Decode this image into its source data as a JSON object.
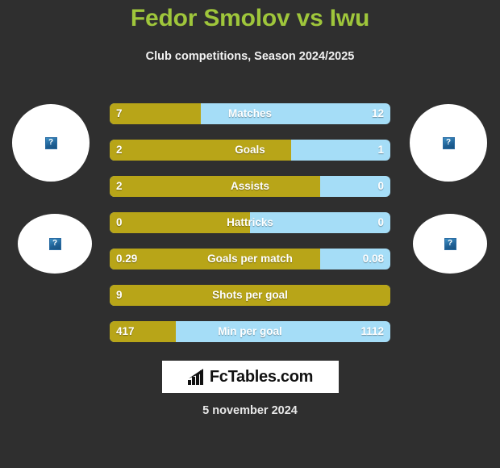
{
  "header": {
    "title": "Fedor Smolov vs Iwu",
    "subtitle": "Club competitions, Season 2024/2025",
    "title_color": "#9fc63b"
  },
  "theme": {
    "background": "#2f2f2f",
    "home_color": "#b8a518",
    "away_color": "#a5ddf7",
    "text_color": "#ffffff"
  },
  "avatars": [
    {
      "name": "player-left-photo",
      "type": "player",
      "state": "broken-image",
      "glyph": "?"
    },
    {
      "name": "player-right-photo",
      "type": "player",
      "state": "broken-image",
      "glyph": "?"
    },
    {
      "name": "team-left-badge",
      "type": "team",
      "state": "broken-image",
      "glyph": "?"
    },
    {
      "name": "team-right-badge",
      "type": "team",
      "state": "broken-image",
      "glyph": "?"
    }
  ],
  "chart_data": {
    "type": "bar",
    "title": "Fedor Smolov vs Iwu",
    "subtitle": "Club competitions, Season 2024/2025",
    "orientation": "horizontal-diverging",
    "categories": [
      "Matches",
      "Goals",
      "Assists",
      "Hattricks",
      "Goals per match",
      "Shots per goal",
      "Min per goal"
    ],
    "series": [
      {
        "name": "Fedor Smolov",
        "color": "#b8a518",
        "values": [
          "7",
          "2",
          "2",
          "0",
          "0.29",
          "9",
          "417"
        ]
      },
      {
        "name": "Iwu",
        "color": "#a5ddf7",
        "values": [
          "12",
          "1",
          "0",
          "0",
          "0.08",
          "",
          "1112"
        ]
      }
    ],
    "fill_percent": [
      32.5,
      64.7,
      75.0,
      50.0,
      75.0,
      100.0,
      23.6
    ],
    "grid": false,
    "legend": "none"
  },
  "rows": [
    {
      "label": "Matches",
      "left": "7",
      "right": "12",
      "fill": 32.5
    },
    {
      "label": "Goals",
      "left": "2",
      "right": "1",
      "fill": 64.7
    },
    {
      "label": "Assists",
      "left": "2",
      "right": "0",
      "fill": 75.0
    },
    {
      "label": "Hattricks",
      "left": "0",
      "right": "0",
      "fill": 50.0
    },
    {
      "label": "Goals per match",
      "left": "0.29",
      "right": "0.08",
      "fill": 75.0
    },
    {
      "label": "Shots per goal",
      "left": "9",
      "right": "",
      "fill": 100.0
    },
    {
      "label": "Min per goal",
      "left": "417",
      "right": "1112",
      "fill": 23.6
    }
  ],
  "footer": {
    "logo_text": "FcTables.com",
    "logo_icon": "bar-chart-icon",
    "date": "5 november 2024"
  }
}
